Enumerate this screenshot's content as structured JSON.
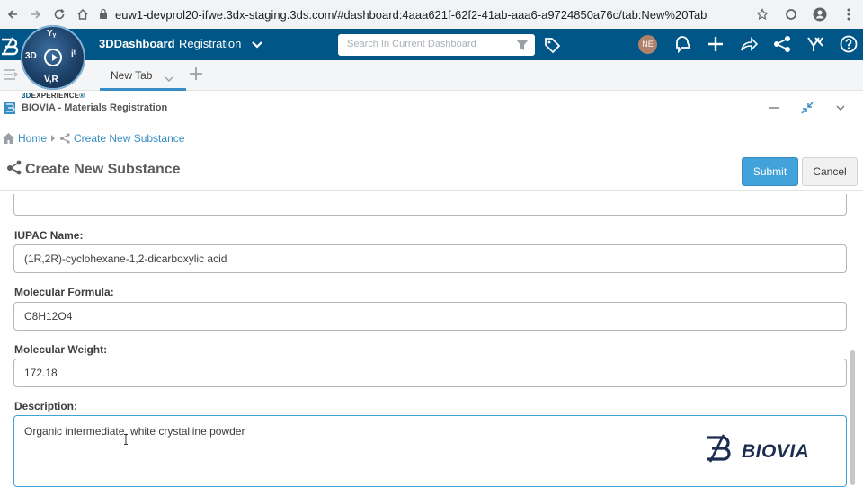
{
  "browser": {
    "url": "euw1-devprol20-ifwe.3dx-staging.3ds.com/#dashboard:4aaa621f-62f2-41ab-aaa6-a9724850a76c/tab:New%20Tab"
  },
  "topbar": {
    "app_title": "3DDashboard",
    "app_subtitle": "Registration",
    "search_placeholder": "Search In Current Dashboard",
    "avatar_initials": "NE"
  },
  "compass": {
    "top": "Yᵧ",
    "left": "3D",
    "right": "iᵗ",
    "bottom": "V,R"
  },
  "tabs": [
    {
      "label": "New Tab",
      "active": true
    }
  ],
  "brand": {
    "prefix": "3D",
    "name": "EXPERIENCE"
  },
  "widget": {
    "title": "BIOVIA - Materials Registration"
  },
  "breadcrumb": {
    "home": "Home",
    "current": "Create New Substance"
  },
  "page": {
    "title": "Create New Substance",
    "submit_label": "Submit",
    "cancel_label": "Cancel"
  },
  "form": {
    "iupac_label": "IUPAC Name:",
    "iupac_value": "(1R,2R)-cyclohexane-1,2-dicarboxylic acid",
    "formula_label": "Molecular Formula:",
    "formula_value": "C8H12O4",
    "weight_label": "Molecular Weight:",
    "weight_value": "172.18",
    "description_label": "Description:",
    "description_value": "Organic intermediate, white crystalline powder"
  },
  "footer_logo": {
    "text": "BIOVIA"
  },
  "colors": {
    "topbar": "#005686",
    "accent": "#42a2da",
    "tab_underline": "#368ec4"
  }
}
